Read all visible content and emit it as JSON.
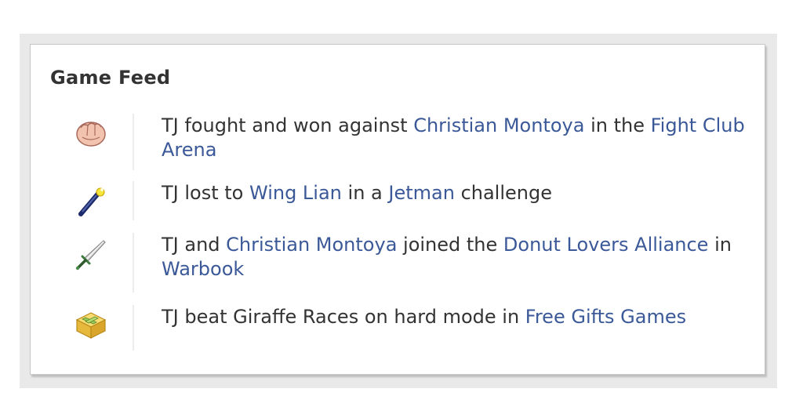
{
  "feed": {
    "title": "Game Feed",
    "items": [
      {
        "icon": "fist-icon",
        "parts": [
          "TJ fought and won against ",
          "Christian Montoya",
          " in the ",
          "Fight Club Arena",
          ""
        ]
      },
      {
        "icon": "jetpack-wand-icon",
        "parts": [
          "TJ lost to ",
          "Wing Lian",
          " in a ",
          "Jetman",
          " challenge"
        ]
      },
      {
        "icon": "sword-icon",
        "parts": [
          "TJ and ",
          "Christian Montoya",
          " joined the ",
          "Donut Lovers Alliance",
          " in ",
          "Warbook"
        ]
      },
      {
        "icon": "gift-box-icon",
        "parts": [
          "TJ beat Giraffe Races on hard mode in ",
          "Free Gifts Games"
        ]
      }
    ]
  },
  "colors": {
    "link": "#3b5998",
    "text": "#333333",
    "border": "#c6c6c6",
    "outer_bg": "#e9e9e9"
  }
}
